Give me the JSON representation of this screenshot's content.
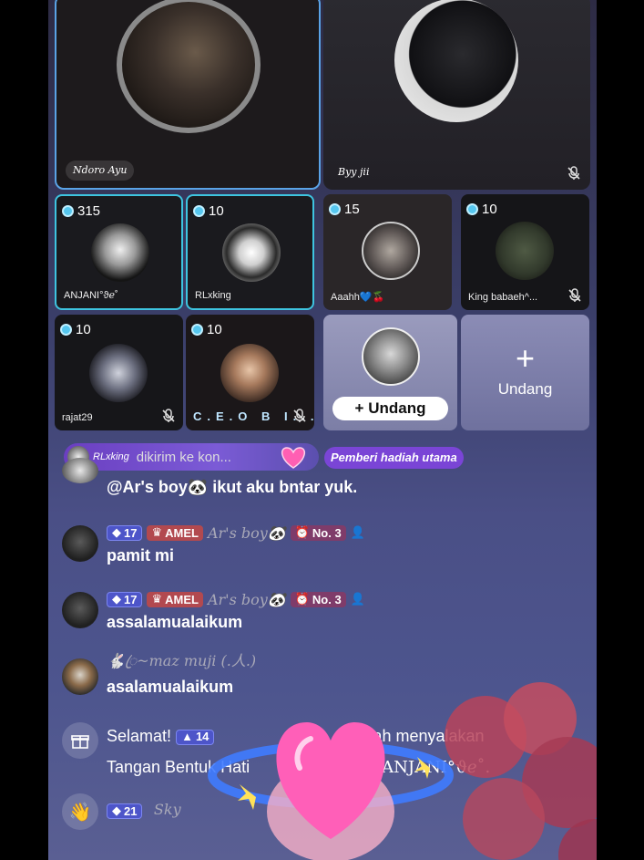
{
  "top_seats": {
    "left": {
      "name": "Ndoro Ayu"
    },
    "right": {
      "name": "Byy jii"
    }
  },
  "seats": [
    {
      "coins": "315",
      "name": "ANJANI°ϑℯ˚"
    },
    {
      "coins": "10",
      "name": "RLxking"
    },
    {
      "coins": "15",
      "name": "Aaahh💙🍒"
    },
    {
      "coins": "10",
      "name": "King babaeh^..."
    },
    {
      "coins": "10",
      "name": "rajat29"
    },
    {
      "coins": "10",
      "name": "C.E.O B I..."
    }
  ],
  "invite": {
    "label": "Undang",
    "plus": "+"
  },
  "invite_alt": {
    "label": "Undang",
    "plus": "+"
  },
  "gift_banner": {
    "user": "RLxking",
    "text": "dikirim ke kon...",
    "top_gifter": "Pemberi hadiah utama"
  },
  "chat": [
    {
      "text": "@Ar's boy🐼 ikut aku bntar yuk."
    },
    {
      "level": "17",
      "amel": "AMEL",
      "name": "Ar's boy🐼",
      "rank": "No. 3",
      "text": "pamit mi"
    },
    {
      "level": "17",
      "amel": "AMEL",
      "name": "Ar's boy🐼",
      "rank": "No. 3",
      "text": "assalamualaikum"
    },
    {
      "name": "🐇ꦿ~maz muji (.人.)",
      "text": "asalamualaikum"
    }
  ],
  "system_messages": [
    {
      "line1": "Selamat!",
      "level": "14",
      "line1_tail": "telah menyalakan",
      "line2": "Tangan Bentuk Hati",
      "line2_tail": "ANJANI°ϑℯ˚."
    },
    {
      "level": "21",
      "name": "Sky"
    }
  ],
  "colors": {
    "accent_cyan": "#3ec4e0",
    "level_badge": "#4d55c9",
    "amel_badge": "#b2494f",
    "gift_purple": "#7a45d6"
  }
}
